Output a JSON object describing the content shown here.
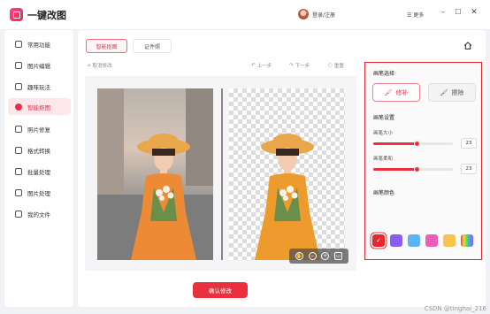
{
  "app": {
    "title": "一键改图",
    "user_label": "登录/注册",
    "menu_label": "更多",
    "minimize": "–",
    "maximize": "☐",
    "close": "✕"
  },
  "sidebar": {
    "items": [
      {
        "label": "常用功能",
        "icon": "grid-icon"
      },
      {
        "label": "图片编辑",
        "icon": "image-edit-icon"
      },
      {
        "label": "趣味玩法",
        "icon": "magic-icon"
      },
      {
        "label": "智能抠图",
        "icon": "cutout-icon",
        "active": true
      },
      {
        "label": "照片修复",
        "icon": "photo-repair-icon"
      },
      {
        "label": "格式转换",
        "icon": "convert-icon"
      },
      {
        "label": "批量处理",
        "icon": "layers-icon"
      },
      {
        "label": "图片处理",
        "icon": "image-process-icon"
      },
      {
        "label": "我的文件",
        "icon": "folder-icon"
      }
    ]
  },
  "tabs": [
    {
      "label": "智能抠图",
      "active": true
    },
    {
      "label": "证件照",
      "active": false
    }
  ],
  "toolbar": {
    "cancel": "取消修改",
    "undo": "上一步",
    "redo": "下一步",
    "reset": "重置"
  },
  "confirm_label": "确认修改",
  "panel": {
    "brush_title": "画笔选择",
    "repair_label": "修补",
    "erase_label": "擦除",
    "settings_title": "画笔设置",
    "size_label": "画笔大小",
    "size_value": "23",
    "softness_label": "画笔柔和",
    "softness_value": "23",
    "size_level": 0.55,
    "softness_level": 0.55,
    "color_title": "画笔颜色",
    "colors": [
      "#e8262f",
      "#8b5cf6",
      "#5ab4f5",
      "#ec5fb9",
      "#f8c24d",
      "rainbow"
    ]
  },
  "watermark": "CSDN @tinghai_216",
  "colors": {
    "accent": "#e8303f"
  }
}
